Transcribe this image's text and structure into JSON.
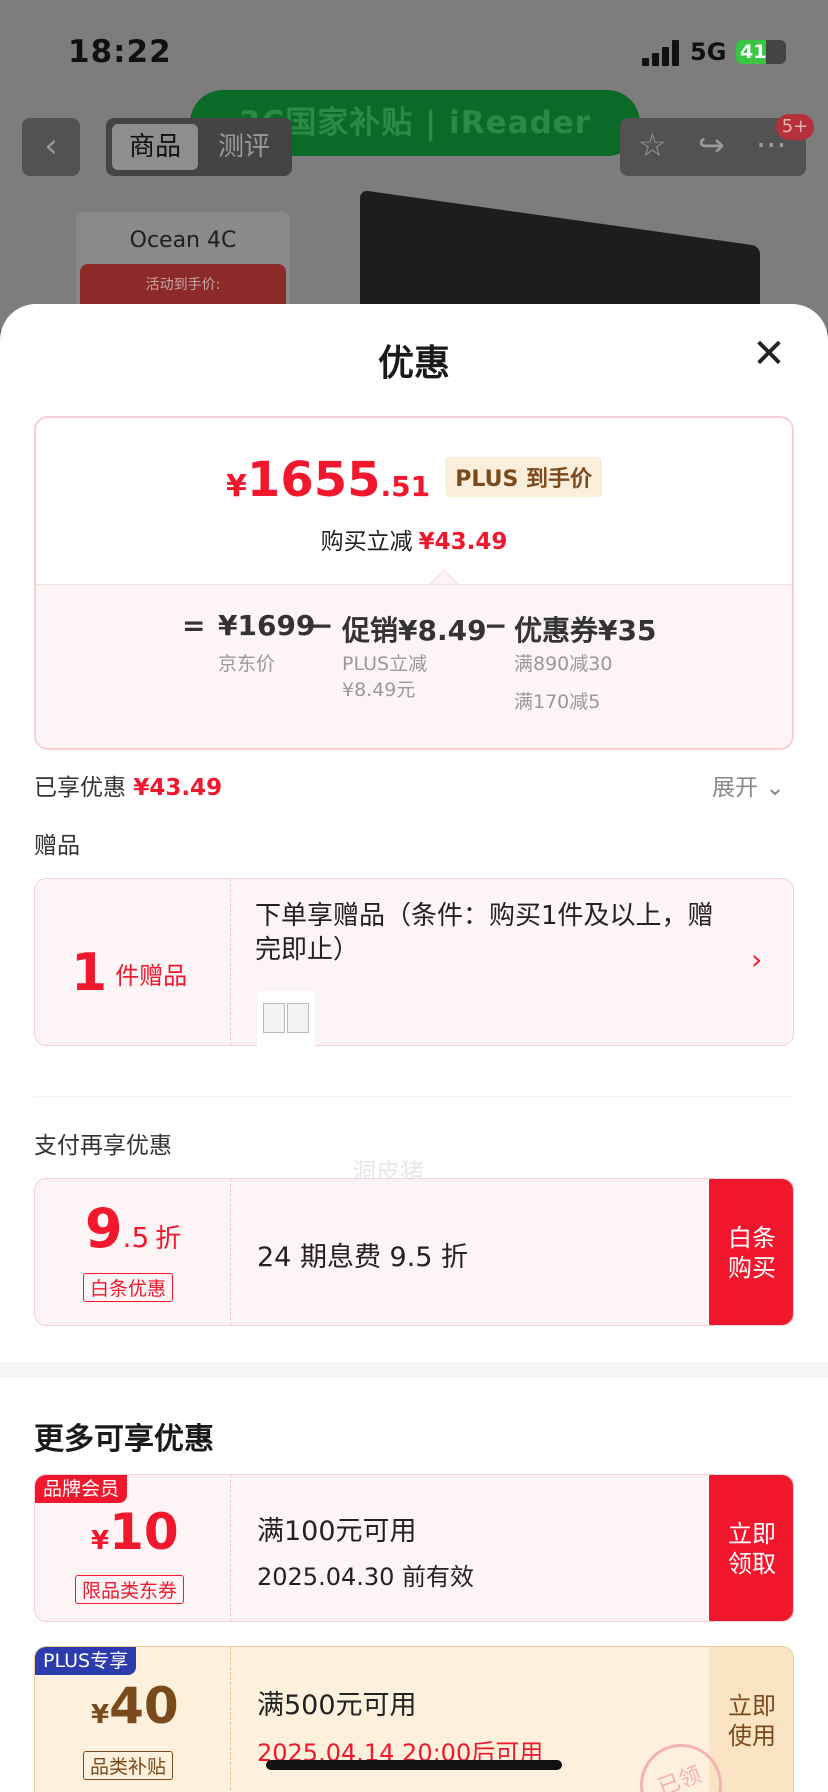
{
  "status_bar": {
    "time": "18:22",
    "network": "5G",
    "battery": "41"
  },
  "background": {
    "banner": "3C国家补贴 | iReader",
    "tabs": [
      "商品",
      "测评"
    ],
    "badge": "5+",
    "product_name": "Ocean 4C",
    "product_price_label": "活动到手价:"
  },
  "sheet": {
    "title": "优惠",
    "price_card": {
      "currency": "¥",
      "price_integer": "1655",
      "price_decimal": ".51",
      "plus_tag": "PLUS 到手价",
      "save_label": "购买立减",
      "save_amount": "¥43.49",
      "equals": "=",
      "minus": "−",
      "breakdown": [
        {
          "amount": "¥1699",
          "label": "京东价"
        },
        {
          "amount": "促销¥8.49",
          "label": "PLUS立减",
          "label2": "¥8.49元"
        },
        {
          "amount": "优惠券¥35",
          "label": "满890减30",
          "label2": "满170减5"
        }
      ]
    },
    "enjoyed_label": "已享优惠",
    "enjoyed_amount": "¥43.49",
    "expand_label": "展开",
    "gift_section": {
      "title": "赠品",
      "count": "1",
      "count_label": "件赠品",
      "description": "下单享赠品（条件：购买1件及以上，赠完即止）"
    },
    "watermark": "洞皮猪",
    "pay_section": {
      "title": "支付再享优惠",
      "discount_big": "9",
      "discount_small": ".5",
      "discount_unit": "折",
      "tag": "白条优惠",
      "description": "24 期息费 9.5 折",
      "button": "白条购买"
    },
    "more_section": {
      "title": "更多可享优惠",
      "coupons": [
        {
          "badge": "品牌会员",
          "currency": "¥",
          "amount": "10",
          "tag": "限品类东券",
          "condition": "满100元可用",
          "validity": "2025.04.30 前有效",
          "button": "立即领取"
        },
        {
          "badge": "PLUS专享",
          "currency": "¥",
          "amount": "40",
          "tag": "品类补贴",
          "condition": "满500元可用",
          "validity": "2025.04.14 20:00后可用",
          "button": "立即使用",
          "stamp": "已领"
        }
      ]
    }
  },
  "colors": {
    "accent_red": "#f1182e",
    "plus_gold": "#7a4a1c",
    "plus_blue": "#2c3cae"
  }
}
